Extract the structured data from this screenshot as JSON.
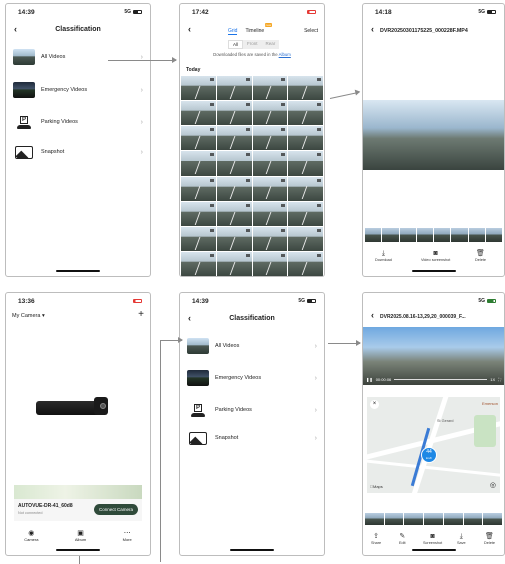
{
  "screen1": {
    "time": "14:39",
    "signal": "5G",
    "title": "Classification",
    "items": [
      {
        "label": "All Videos",
        "icon": "video-thumbnail"
      },
      {
        "label": "Emergency Videos",
        "icon": "emergency-thumbnail"
      },
      {
        "label": "Parking Videos",
        "icon": "parking-icon"
      },
      {
        "label": "Snapshot",
        "icon": "image-icon"
      }
    ]
  },
  "screen2": {
    "time": "17:42",
    "tabs": [
      "Grid",
      "Timeline"
    ],
    "timeline_badge": "new",
    "select_label": "Select",
    "filters": [
      "All",
      "Front",
      "Rear"
    ],
    "info_text": "Downloaded files are saved in the",
    "info_link": "Album",
    "section": "Today"
  },
  "screen3": {
    "time": "14:18",
    "signal": "5G",
    "title": "DVR20250301175225_000228F.MP4",
    "toolbar": [
      "Download",
      "Video screenshot",
      "Delete"
    ]
  },
  "screen4": {
    "time": "13:36",
    "camera_menu": "My Camera",
    "add_label": "+",
    "device_name": "AUTOVUE-DR-41_60d8",
    "device_status": "Not connected",
    "connect_label": "Connect Camera",
    "nav": [
      "Camera",
      "Album",
      "More"
    ]
  },
  "screen5": {
    "time": "14:39",
    "signal": "5G",
    "title": "Classification",
    "items": [
      {
        "label": "All Videos"
      },
      {
        "label": "Emergency Videos"
      },
      {
        "label": "Parking Videos"
      },
      {
        "label": "Snapshot"
      }
    ]
  },
  "screen6": {
    "signal": "5G",
    "title": "DVR2025.08.16-13,29,20_000039_F...",
    "video_time": "00:00:06",
    "video_speed": "1X",
    "map_label": "Maps",
    "speed_value": "44",
    "speed_unit": "km/h",
    "place_1": "Emerson",
    "place_2": "St Gerard",
    "toolbar": [
      "Share",
      "Edit",
      "Screenshot",
      "Save",
      "Delete"
    ]
  },
  "colors": {
    "accent_link": "#2a6fd1",
    "tab_active": "#1a73e8",
    "connect_button": "#2f4a3a",
    "frame_border": "#bdbdbd",
    "arrow": "#8a8a8a"
  }
}
